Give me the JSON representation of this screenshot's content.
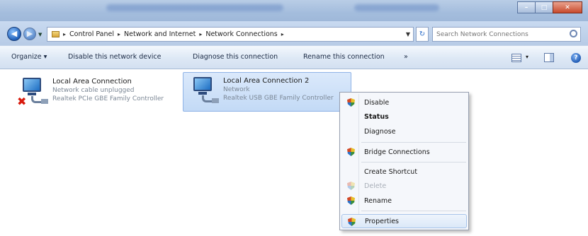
{
  "window": {
    "min_glyph": "–",
    "max_glyph": "□",
    "close_glyph": "✕"
  },
  "address": {
    "back_glyph": "◀",
    "fwd_glyph": "▶",
    "recent_glyph": "▼",
    "breadcrumbs": [
      "Control Panel",
      "Network and Internet",
      "Network Connections"
    ],
    "separator": "▸",
    "drop_glyph": "▼",
    "refresh_glyph": "↻",
    "search_placeholder": "Search Network Connections"
  },
  "toolbar": {
    "organize": "Organize ▾",
    "disable_device": "Disable this network device",
    "diagnose": "Diagnose this connection",
    "rename": "Rename this connection",
    "more": "»",
    "views_drop": "▾",
    "help": "?"
  },
  "connections": [
    {
      "name": "Local Area Connection",
      "status": "Network cable unplugged",
      "device": "Realtek PCIe GBE Family Controller",
      "error_glyph": "✖",
      "selected": false
    },
    {
      "name": "Local Area Connection 2",
      "status": "Network",
      "device": "Realtek USB GBE Family Controller",
      "selected": true
    }
  ],
  "context_menu": {
    "items": [
      {
        "label": "Disable",
        "shield": true,
        "bold": false
      },
      {
        "label": "Status",
        "shield": false,
        "bold": true
      },
      {
        "label": "Diagnose",
        "shield": false,
        "bold": false
      },
      {
        "label": "Bridge Connections",
        "shield": true,
        "bold": false
      },
      {
        "label": "Create Shortcut",
        "shield": false,
        "bold": false
      },
      {
        "label": "Delete",
        "shield": true,
        "bold": false,
        "disabled": true
      },
      {
        "label": "Rename",
        "shield": true,
        "bold": false
      },
      {
        "label": "Properties",
        "shield": true,
        "bold": false,
        "highlight": true
      }
    ]
  }
}
